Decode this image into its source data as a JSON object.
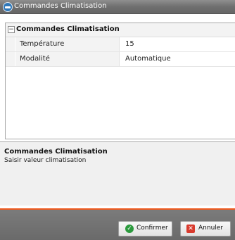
{
  "window": {
    "title": "Commandes Climatisation"
  },
  "property_grid": {
    "category": "Commandes Climatisation",
    "rows": [
      {
        "name": "Température",
        "value": "15"
      },
      {
        "name": "Modalité",
        "value": "Automatique"
      }
    ]
  },
  "description": {
    "title": "Commandes Climatisation",
    "text": "Saisir valeur climatisation"
  },
  "buttons": {
    "confirm": "Confirmer",
    "cancel": "Annuler"
  },
  "colors": {
    "accent": "#f05a1e",
    "footer": "#707070"
  },
  "icons": {
    "window": "app-icon",
    "collapse": "minus-icon",
    "confirm": "check-icon",
    "cancel": "cancel-icon"
  }
}
